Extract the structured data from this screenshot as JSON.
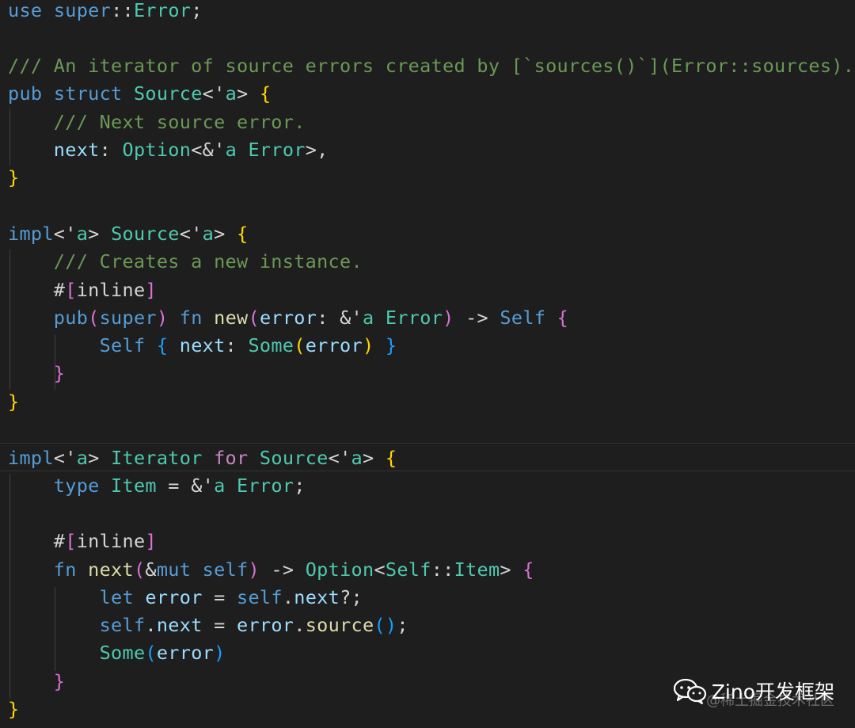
{
  "colors": {
    "keyword": "#569cd6",
    "control": "#c586c0",
    "type": "#4ec9b0",
    "function": "#dcdcaa",
    "variable": "#9cdcfe",
    "plain": "#d4d4d4",
    "comment": "#6a9955",
    "bracket_gold": "#ffd700",
    "bracket_pink": "#da70d6",
    "bracket_blue": "#179fff",
    "whitespace": "#3b3b3b",
    "background": "#1e1e1e"
  },
  "code_lines": [
    [
      [
        "use",
        "keyword"
      ],
      [
        " ",
        "ws"
      ],
      [
        "super",
        "keyword"
      ],
      [
        "::",
        "plain"
      ],
      [
        "Error",
        "type"
      ],
      [
        ";",
        "plain"
      ]
    ],
    [],
    [
      [
        "/// An iterator of source errors created by [`sources()`](Error::sources).",
        "comment"
      ]
    ],
    [
      [
        "pub",
        "keyword"
      ],
      [
        " ",
        "ws"
      ],
      [
        "struct",
        "keyword"
      ],
      [
        " ",
        "ws"
      ],
      [
        "Source",
        "type"
      ],
      [
        "<'",
        "plain"
      ],
      [
        "a",
        "type"
      ],
      [
        ">",
        "plain"
      ],
      [
        " ",
        "ws"
      ],
      [
        "{",
        "bracket_gold"
      ]
    ],
    [
      [
        "    ",
        "ws"
      ],
      [
        "/// Next source error.",
        "comment"
      ]
    ],
    [
      [
        "    ",
        "ws"
      ],
      [
        "next",
        "variable"
      ],
      [
        ": ",
        "plain"
      ],
      [
        "Option",
        "type"
      ],
      [
        "<&'",
        "plain"
      ],
      [
        "a",
        "type"
      ],
      [
        " ",
        "ws"
      ],
      [
        "Error",
        "type"
      ],
      [
        ">,",
        "plain"
      ]
    ],
    [
      [
        "}",
        "bracket_gold"
      ]
    ],
    [],
    [
      [
        "impl",
        "keyword"
      ],
      [
        "<'",
        "plain"
      ],
      [
        "a",
        "type"
      ],
      [
        ">",
        "plain"
      ],
      [
        " ",
        "ws"
      ],
      [
        "Source",
        "type"
      ],
      [
        "<'",
        "plain"
      ],
      [
        "a",
        "type"
      ],
      [
        ">",
        "plain"
      ],
      [
        " ",
        "ws"
      ],
      [
        "{",
        "bracket_gold"
      ]
    ],
    [
      [
        "    ",
        "ws"
      ],
      [
        "/// Creates a new instance.",
        "comment"
      ]
    ],
    [
      [
        "    ",
        "ws"
      ],
      [
        "#",
        "plain"
      ],
      [
        "[",
        "bracket_pink"
      ],
      [
        "inline",
        "plain"
      ],
      [
        "]",
        "bracket_pink"
      ]
    ],
    [
      [
        "    ",
        "ws"
      ],
      [
        "pub",
        "keyword"
      ],
      [
        "(",
        "bracket_pink"
      ],
      [
        "super",
        "keyword"
      ],
      [
        ")",
        "bracket_pink"
      ],
      [
        " ",
        "ws"
      ],
      [
        "fn",
        "keyword"
      ],
      [
        " ",
        "ws"
      ],
      [
        "new",
        "function"
      ],
      [
        "(",
        "bracket_pink"
      ],
      [
        "error",
        "variable"
      ],
      [
        ":",
        "plain"
      ],
      [
        " ",
        "ws"
      ],
      [
        "&'",
        "plain"
      ],
      [
        "a",
        "type"
      ],
      [
        " ",
        "ws"
      ],
      [
        "Error",
        "type"
      ],
      [
        ")",
        "bracket_pink"
      ],
      [
        " ",
        "ws"
      ],
      [
        "->",
        "plain"
      ],
      [
        " ",
        "ws"
      ],
      [
        "Self",
        "keyword"
      ],
      [
        " ",
        "ws"
      ],
      [
        "{",
        "bracket_pink"
      ]
    ],
    [
      [
        "        ",
        "ws"
      ],
      [
        "Self",
        "keyword"
      ],
      [
        " ",
        "ws"
      ],
      [
        "{",
        "bracket_blue"
      ],
      [
        " ",
        "ws"
      ],
      [
        "next",
        "variable"
      ],
      [
        ":",
        "plain"
      ],
      [
        " ",
        "ws"
      ],
      [
        "Some",
        "type"
      ],
      [
        "(",
        "bracket_gold"
      ],
      [
        "error",
        "variable"
      ],
      [
        ")",
        "bracket_gold"
      ],
      [
        " ",
        "ws"
      ],
      [
        "}",
        "bracket_blue"
      ]
    ],
    [
      [
        "    ",
        "ws"
      ],
      [
        "}",
        "bracket_pink"
      ]
    ],
    [
      [
        "}",
        "bracket_gold"
      ]
    ],
    [],
    [
      [
        "impl",
        "keyword"
      ],
      [
        "<'",
        "plain"
      ],
      [
        "a",
        "type"
      ],
      [
        ">",
        "plain"
      ],
      [
        " ",
        "ws"
      ],
      [
        "Iterator",
        "type"
      ],
      [
        " ",
        "ws"
      ],
      [
        "for",
        "control"
      ],
      [
        " ",
        "ws"
      ],
      [
        "Source",
        "type"
      ],
      [
        "<'",
        "plain"
      ],
      [
        "a",
        "type"
      ],
      [
        ">",
        "plain"
      ],
      [
        " ",
        "ws"
      ],
      [
        "{",
        "bracket_gold"
      ]
    ],
    [
      [
        "    ",
        "ws"
      ],
      [
        "type",
        "keyword"
      ],
      [
        " ",
        "ws"
      ],
      [
        "Item",
        "type"
      ],
      [
        " ",
        "ws"
      ],
      [
        "=",
        "plain"
      ],
      [
        " ",
        "ws"
      ],
      [
        "&'",
        "plain"
      ],
      [
        "a",
        "type"
      ],
      [
        " ",
        "ws"
      ],
      [
        "Error",
        "type"
      ],
      [
        ";",
        "plain"
      ]
    ],
    [],
    [
      [
        "    ",
        "ws"
      ],
      [
        "#",
        "plain"
      ],
      [
        "[",
        "bracket_pink"
      ],
      [
        "inline",
        "plain"
      ],
      [
        "]",
        "bracket_pink"
      ]
    ],
    [
      [
        "    ",
        "ws"
      ],
      [
        "fn",
        "keyword"
      ],
      [
        " ",
        "ws"
      ],
      [
        "next",
        "function"
      ],
      [
        "(",
        "bracket_pink"
      ],
      [
        "&",
        "plain"
      ],
      [
        "mut",
        "keyword"
      ],
      [
        " ",
        "ws"
      ],
      [
        "self",
        "keyword"
      ],
      [
        ")",
        "bracket_pink"
      ],
      [
        " ",
        "ws"
      ],
      [
        "->",
        "plain"
      ],
      [
        " ",
        "ws"
      ],
      [
        "Option",
        "type"
      ],
      [
        "<",
        "plain"
      ],
      [
        "Self",
        "type"
      ],
      [
        "::",
        "plain"
      ],
      [
        "Item",
        "type"
      ],
      [
        ">",
        "plain"
      ],
      [
        " ",
        "ws"
      ],
      [
        "{",
        "bracket_pink"
      ]
    ],
    [
      [
        "        ",
        "ws"
      ],
      [
        "let",
        "keyword"
      ],
      [
        " ",
        "ws"
      ],
      [
        "error",
        "variable"
      ],
      [
        " ",
        "ws"
      ],
      [
        "=",
        "plain"
      ],
      [
        " ",
        "ws"
      ],
      [
        "self",
        "keyword"
      ],
      [
        ".",
        "plain"
      ],
      [
        "next",
        "variable"
      ],
      [
        "?;",
        "plain"
      ]
    ],
    [
      [
        "        ",
        "ws"
      ],
      [
        "self",
        "keyword"
      ],
      [
        ".",
        "plain"
      ],
      [
        "next",
        "variable"
      ],
      [
        " ",
        "ws"
      ],
      [
        "=",
        "plain"
      ],
      [
        " ",
        "ws"
      ],
      [
        "error",
        "variable"
      ],
      [
        ".",
        "plain"
      ],
      [
        "source",
        "function"
      ],
      [
        "(",
        "bracket_blue"
      ],
      [
        ")",
        "bracket_blue"
      ],
      [
        ";",
        "plain"
      ]
    ],
    [
      [
        "        ",
        "ws"
      ],
      [
        "Some",
        "type"
      ],
      [
        "(",
        "bracket_blue"
      ],
      [
        "error",
        "variable"
      ],
      [
        ")",
        "bracket_blue"
      ]
    ],
    [
      [
        "    ",
        "ws"
      ],
      [
        "}",
        "bracket_pink"
      ]
    ],
    [
      [
        "}",
        "bracket_gold"
      ]
    ]
  ],
  "watermark": {
    "icon": "wechat-icon",
    "label": "Zino开发框架",
    "sublabel": "@稀土掘金技术社区"
  }
}
